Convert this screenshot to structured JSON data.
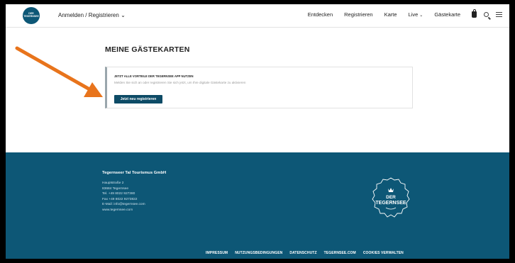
{
  "header": {
    "logo_line1": "DER",
    "logo_line2": "TEGERNSEE",
    "login_label": "Anmelden / Registrieren",
    "login_chevron": "⌄",
    "nav": [
      {
        "label": "Entdecken"
      },
      {
        "label": "Registrieren"
      },
      {
        "label": "Karte"
      },
      {
        "label": "Live",
        "chevron": "⌄"
      },
      {
        "label": "Gästekarte"
      }
    ],
    "icons": [
      "bag-icon",
      "search-icon",
      "menu-icon"
    ]
  },
  "main": {
    "title": "MEINE GÄSTEKARTEN",
    "card": {
      "heading": "JETZT ALLE VORTEILE DER TEGERNSEE APP NUTZEN",
      "text": "Melden Sie sich an oder registrieren Sie sich jetzt, um Ihre digitale Gästekarte zu aktivieren",
      "button": "Jetzt neu registrieren"
    },
    "annotation_arrow_color": "#e8741c"
  },
  "footer": {
    "company": "Tegernseer Tal Tourismus GmbH",
    "address": [
      "Hauptstraße 2",
      "83684 Tegernsee",
      "Tel. +49 8022 927380",
      "Fax +49 8022 9273822",
      "E-Mail: info@tegernsee.com",
      "www.tegernsee.com"
    ],
    "seal_line1": "DER",
    "seal_line2": "TEGERNSEE",
    "links": [
      "IMPRESSUM",
      "NUTZUNGSBEDINGUNGEN",
      "DATENSCHUTZ",
      "TEGERNSEE.COM",
      "COOKIES VERWALTEN"
    ],
    "background": "#0d5776"
  }
}
